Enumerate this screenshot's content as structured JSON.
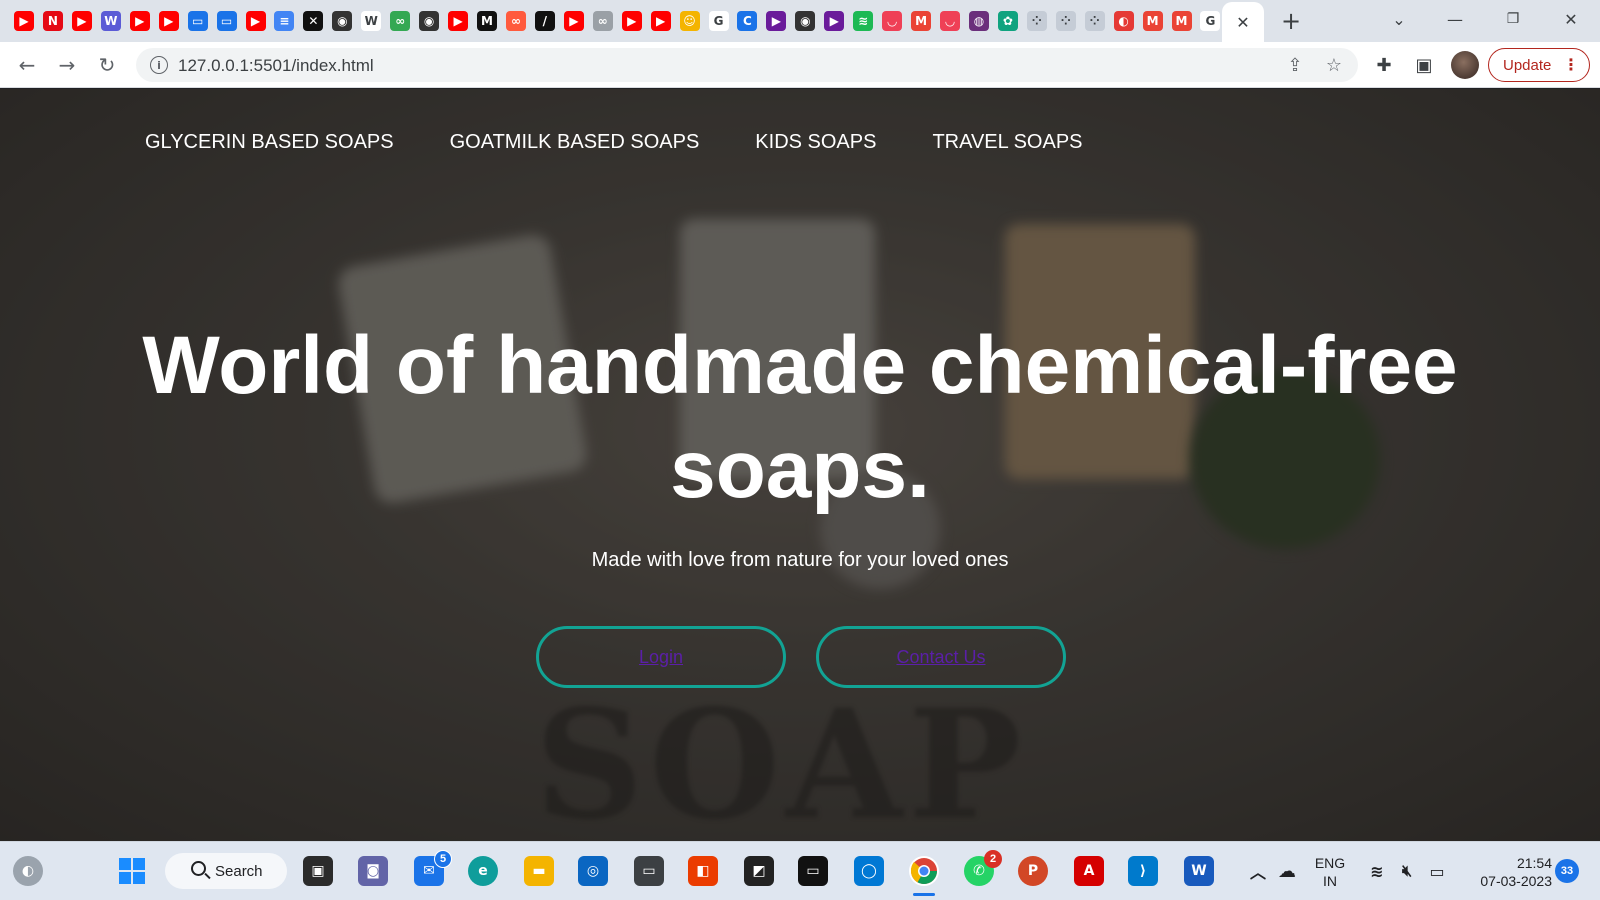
{
  "browser": {
    "tab_favicons": [
      {
        "name": "youtube-icon",
        "color": "#ff0000",
        "glyph": "▶"
      },
      {
        "name": "netflix-icon",
        "color": "#e50914",
        "glyph": "N"
      },
      {
        "name": "youtube-icon",
        "color": "#ff0000",
        "glyph": "▶"
      },
      {
        "name": "webflow-icon",
        "color": "#5b5bd6",
        "glyph": "W"
      },
      {
        "name": "youtube-icon",
        "color": "#ff0000",
        "glyph": "▶"
      },
      {
        "name": "youtube-icon",
        "color": "#ff0000",
        "glyph": "▶"
      },
      {
        "name": "chat-icon",
        "color": "#1a73e8",
        "glyph": "▭"
      },
      {
        "name": "chat-icon",
        "color": "#1a73e8",
        "glyph": "▭"
      },
      {
        "name": "youtube-icon",
        "color": "#ff0000",
        "glyph": "▶"
      },
      {
        "name": "docs-icon",
        "color": "#4285f4",
        "glyph": "≡"
      },
      {
        "name": "capcut-icon",
        "color": "#111111",
        "glyph": "✕"
      },
      {
        "name": "globe-icon",
        "color": "#333333",
        "glyph": "◉"
      },
      {
        "name": "wikipedia-icon",
        "color": "#ffffff",
        "glyph": "W"
      },
      {
        "name": "link-icon",
        "color": "#34a853",
        "glyph": "∞"
      },
      {
        "name": "globe-icon",
        "color": "#333333",
        "glyph": "◉"
      },
      {
        "name": "youtube-icon",
        "color": "#ff0000",
        "glyph": "▶"
      },
      {
        "name": "medium-icon",
        "color": "#111111",
        "glyph": "M"
      },
      {
        "name": "link-icon",
        "color": "#ff5a3d",
        "glyph": "∞"
      },
      {
        "name": "notion-icon",
        "color": "#111111",
        "glyph": "/"
      },
      {
        "name": "youtube-icon",
        "color": "#ff0000",
        "glyph": "▶"
      },
      {
        "name": "link-icon",
        "color": "#9aa0a6",
        "glyph": "∞"
      },
      {
        "name": "youtube-icon",
        "color": "#ff0000",
        "glyph": "▶"
      },
      {
        "name": "youtube-icon",
        "color": "#ff0000",
        "glyph": "▶"
      },
      {
        "name": "avatar-icon",
        "color": "#f4b400",
        "glyph": "☺"
      },
      {
        "name": "google-icon",
        "color": "#ffffff",
        "glyph": "G"
      },
      {
        "name": "canva-icon",
        "color": "#1a73e8",
        "glyph": "C"
      },
      {
        "name": "arrow-icon",
        "color": "#6a1b9a",
        "glyph": "▶"
      },
      {
        "name": "globe-icon",
        "color": "#333333",
        "glyph": "◉"
      },
      {
        "name": "arrow-icon",
        "color": "#6a1b9a",
        "glyph": "▶"
      },
      {
        "name": "spotify-icon",
        "color": "#1db954",
        "glyph": "≋"
      },
      {
        "name": "pocket-icon",
        "color": "#ef4056",
        "glyph": "◡"
      },
      {
        "name": "gmail-icon",
        "color": "#ea4335",
        "glyph": "M"
      },
      {
        "name": "pocket-icon",
        "color": "#ef4056",
        "glyph": "◡"
      },
      {
        "name": "app-icon",
        "color": "#6b2f7b",
        "glyph": "◍"
      },
      {
        "name": "chatgpt-icon",
        "color": "#10a37f",
        "glyph": "✿"
      },
      {
        "name": "dots-icon",
        "color": "#c5ccd6",
        "glyph": "⁘"
      },
      {
        "name": "dots-icon",
        "color": "#c5ccd6",
        "glyph": "⁘"
      },
      {
        "name": "dots-icon",
        "color": "#c5ccd6",
        "glyph": "⁘"
      },
      {
        "name": "app-icon",
        "color": "#e53935",
        "glyph": "◐"
      },
      {
        "name": "gmail-icon",
        "color": "#ea4335",
        "glyph": "M"
      },
      {
        "name": "gmail-icon",
        "color": "#ea4335",
        "glyph": "M"
      },
      {
        "name": "google-icon",
        "color": "#ffffff",
        "glyph": "G"
      }
    ],
    "address_url": "127.0.0.1:5501/index.html",
    "update_label": "Update"
  },
  "page": {
    "nav": [
      "GLYCERIN BASED SOAPS",
      "GOATMILK BASED SOAPS",
      "KIDS SOAPS",
      "TRAVEL SOAPS"
    ],
    "hero_title": "World of handmade chemical-free soaps.",
    "hero_subtitle": "Made with love from nature for your loved ones",
    "login_label": "Login",
    "contact_label": "Contact Us",
    "background_word": "SOAP",
    "accent_color": "#12a394",
    "link_color": "#5b1fa8"
  },
  "taskbar": {
    "search_label": "Search",
    "mail_badge": "5",
    "whatsapp_badge": "2",
    "language_line1": "ENG",
    "language_line2": "IN",
    "time": "21:54",
    "date": "07-03-2023",
    "notification_count": "33"
  }
}
